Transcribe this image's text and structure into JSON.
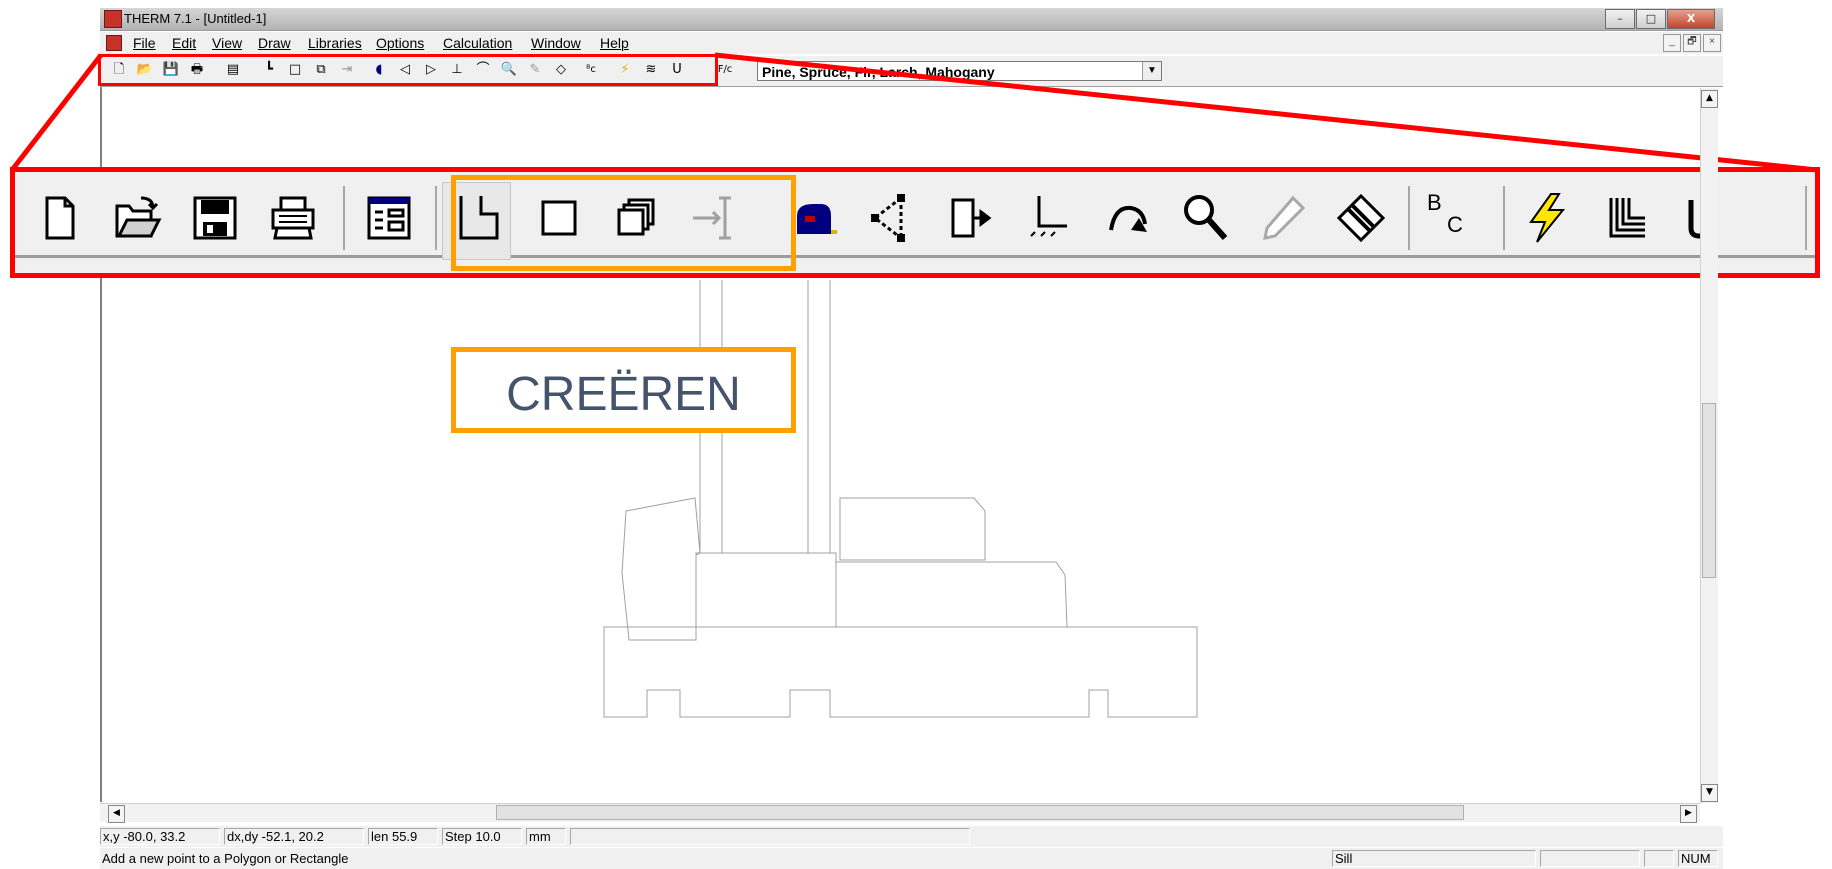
{
  "window": {
    "title": "THERM 7.1 - [Untitled-1]"
  },
  "window_buttons": {
    "minimize": "–",
    "maximize": "□",
    "close": "X"
  },
  "mdi_buttons": {
    "minimize": "_",
    "restore": "🗗",
    "close": "×"
  },
  "menu": [
    "File",
    "Edit",
    "View",
    "Draw",
    "Libraries",
    "Options",
    "Calculation",
    "Window",
    "Help"
  ],
  "toolbar": {
    "material_combo_value": "Pine, Spruce, Fir, Larch, Mahogany",
    "fc_label": "F/c"
  },
  "big_toolbar": {
    "bc_label_top": "B",
    "bc_label_bottom": "C"
  },
  "callout": {
    "label": "CREËREN"
  },
  "status": {
    "xy": "x,y -80.0, 33.2",
    "dxdy": "dx,dy -52.1, 20.2",
    "len": "len  55.9",
    "step": "Step  10.0",
    "unit": "mm",
    "hint": "Add a new point to a Polygon or Rectangle",
    "sill": "Sill",
    "num": "NUM"
  },
  "colors": {
    "highlight_red": "#ff0000",
    "highlight_orange": "#ffa000",
    "callout_text": "#44546a"
  }
}
